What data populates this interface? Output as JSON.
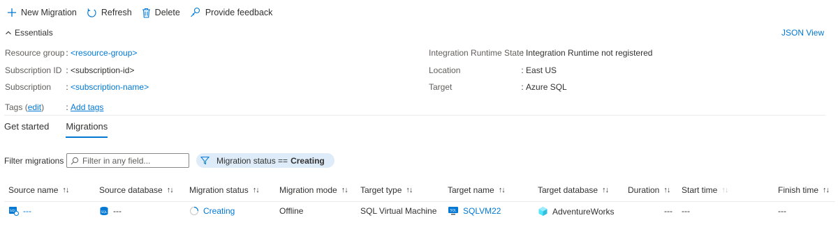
{
  "toolbar": {
    "new_migration": "New Migration",
    "refresh": "Refresh",
    "delete": "Delete",
    "feedback": "Provide feedback"
  },
  "essentials": {
    "title": "Essentials",
    "json_view": "JSON View",
    "left": [
      {
        "key": "Resource group",
        "value": "<resource-group>"
      },
      {
        "key": "Subscription ID",
        "value": "<subscription-id>"
      },
      {
        "key": "Subscription",
        "value": "<subscription-name>"
      }
    ],
    "right": [
      {
        "key": "Integration Runtime State",
        "value": "Integration Runtime not registered"
      },
      {
        "key": "Location",
        "value": "East US"
      },
      {
        "key": "Target",
        "value": "Azure SQL"
      }
    ],
    "tags": {
      "key": "Tags",
      "edit": "edit",
      "add": "Add tags"
    }
  },
  "tabs": [
    {
      "label": "Get started"
    },
    {
      "label": "Migrations"
    }
  ],
  "filter": {
    "label": "Filter migrations",
    "placeholder": "Filter in any field...",
    "pill_text": "Migration status ==",
    "pill_value": "Creating"
  },
  "table": {
    "columns": [
      "Source name",
      "Source database",
      "Migration status",
      "Migration mode",
      "Target type",
      "Target name",
      "Target database",
      "Duration",
      "Start time",
      "Finish time"
    ],
    "row": {
      "source_name": "---",
      "source_database": "---",
      "migration_status": "Creating",
      "migration_mode": "Offline",
      "target_type": "SQL Virtual Machine",
      "target_name": "SQLVM22",
      "target_database": "AdventureWorks",
      "duration": "---",
      "start_time": "---",
      "finish_time": "---"
    }
  },
  "colors": {
    "accent": "#0078d4",
    "pill_bg": "#deecf9"
  }
}
